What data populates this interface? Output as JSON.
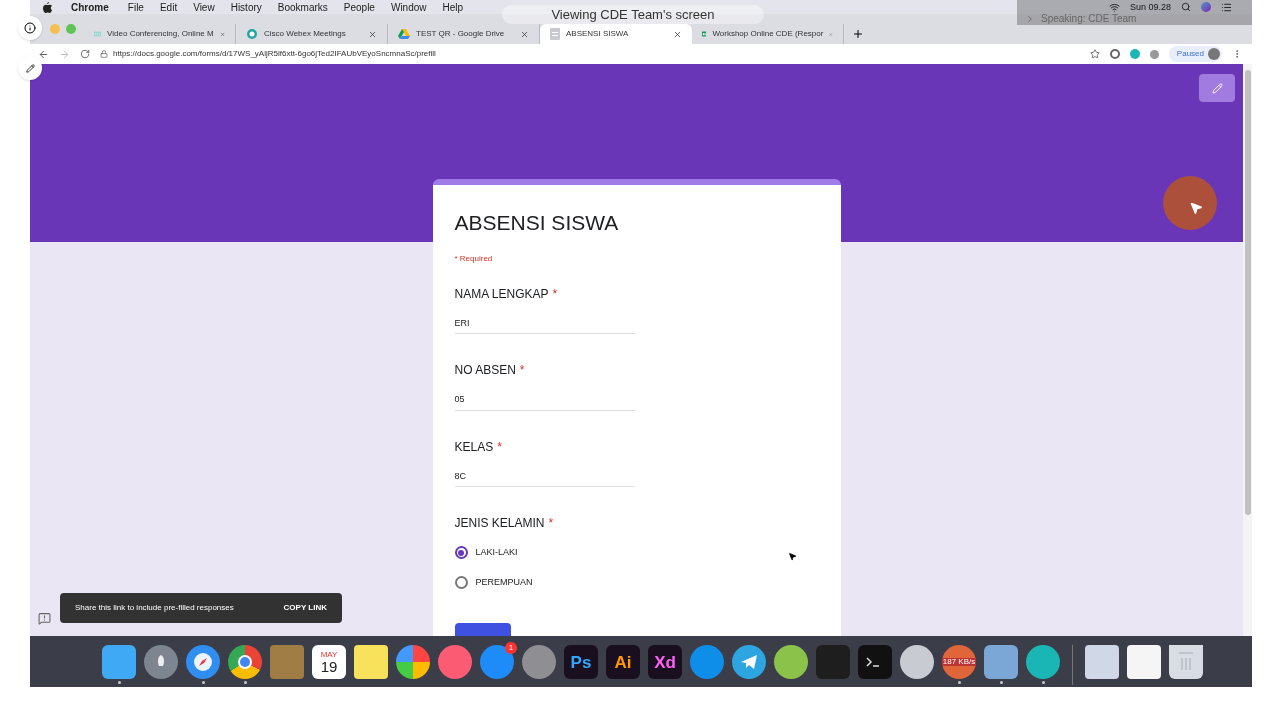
{
  "menu_bar": {
    "app": "Chrome",
    "items": [
      "File",
      "Edit",
      "View",
      "History",
      "Bookmarks",
      "People",
      "Window",
      "Help"
    ],
    "clock": "Sun 09.28"
  },
  "tabs": [
    {
      "title": "Video Conferencing, Online M",
      "selected": false
    },
    {
      "title": "Cisco Webex Meetings",
      "selected": false
    },
    {
      "title": "TEST QR - Google Drive",
      "selected": false
    },
    {
      "title": "ABSENSI SISWA",
      "selected": true
    },
    {
      "title": "Workshop Online CDE (Respor",
      "selected": false
    }
  ],
  "address_bar": {
    "url": "https://docs.google.com/forms/d/17WS_yAljR5lf6xtt-6go6jTed2IFAUbVEyoSncmnaSc/prefill",
    "profile_status": "Paused"
  },
  "share_banner": "Viewing CDE Team's screen",
  "speaker_indicator": "Speaking: CDE Team",
  "form": {
    "title": "ABSENSI SISWA",
    "required_note": "* Required",
    "questions": [
      {
        "kind": "text",
        "label": "NAMA LENGKAP",
        "required_mark": "*",
        "value": "ERI"
      },
      {
        "kind": "text",
        "label": "NO ABSEN",
        "required_mark": "*",
        "value": "05"
      },
      {
        "kind": "text",
        "label": "KELAS",
        "required_mark": "*",
        "value": "8C"
      },
      {
        "kind": "radio",
        "label": "JENIS KELAMIN",
        "required_mark": "*",
        "options": [
          {
            "label": "LAKI-LAKI",
            "selected": true
          },
          {
            "label": "PEREMPUAN",
            "selected": false
          }
        ]
      }
    ]
  },
  "snackbar": {
    "message": "Share this link to include pre-filled responses",
    "action": "COPY LINK"
  },
  "dock": [
    {
      "kind": "finder",
      "running": true
    },
    {
      "kind": "launchpad",
      "running": false
    },
    {
      "kind": "safari",
      "running": true
    },
    {
      "kind": "chrome",
      "running": true
    },
    {
      "kind": "notebook",
      "running": false
    },
    {
      "kind": "calendar",
      "running": false,
      "month": "MAY",
      "day": "19"
    },
    {
      "kind": "notes",
      "running": false
    },
    {
      "kind": "photos",
      "running": false
    },
    {
      "kind": "music",
      "running": false
    },
    {
      "kind": "appstore",
      "running": false,
      "badge": "1"
    },
    {
      "kind": "settings",
      "running": false
    },
    {
      "kind": "adobe",
      "running": false,
      "text": "Ps",
      "color": "#31a8ff"
    },
    {
      "kind": "adobe",
      "running": false,
      "text": "Ai",
      "color": "#ff9a00"
    },
    {
      "kind": "adobe",
      "running": false,
      "text": "Xd",
      "color": "#ff61f6"
    },
    {
      "kind": "teamviewer",
      "running": false
    },
    {
      "kind": "telegram",
      "running": false
    },
    {
      "kind": "android",
      "running": false
    },
    {
      "kind": "vscode",
      "running": false
    },
    {
      "kind": "terminal",
      "running": false
    },
    {
      "kind": "gears",
      "running": false
    },
    {
      "kind": "meter",
      "running": true,
      "text": "187 KB/s"
    },
    {
      "kind": "preview",
      "running": true
    },
    {
      "kind": "webex",
      "running": true
    },
    {
      "kind": "separator"
    },
    {
      "kind": "rocketfile",
      "running": false
    },
    {
      "kind": "docs",
      "running": false
    },
    {
      "kind": "trash",
      "running": false
    }
  ]
}
